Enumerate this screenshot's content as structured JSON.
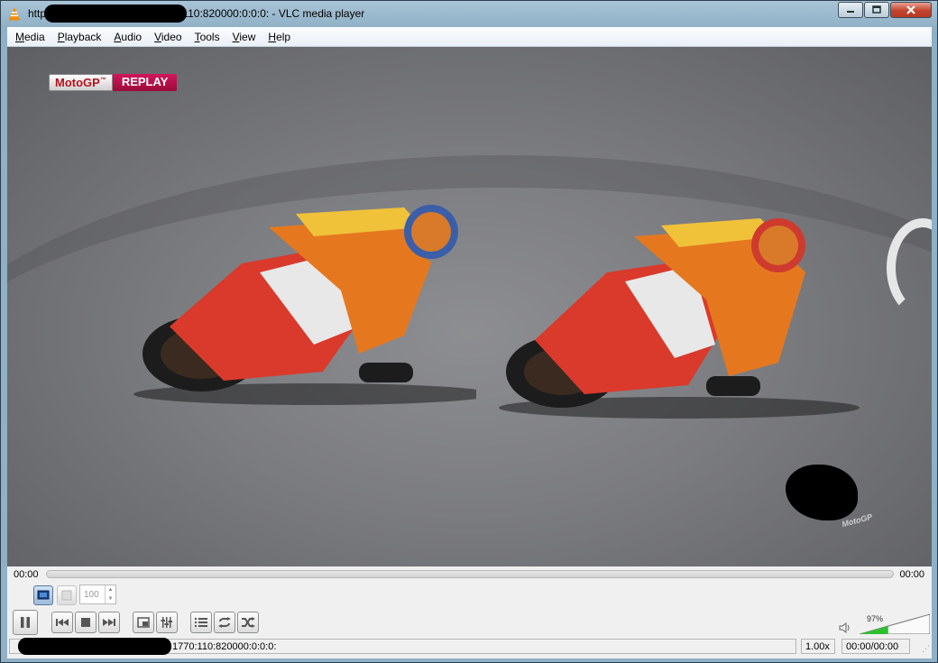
{
  "window": {
    "title": "http                         770:110:820000:0:0:0: - VLC media player",
    "title_suffix": ":110:820000:0:0:0: - VLC media player",
    "title_prefix": "http"
  },
  "menu": {
    "items": [
      {
        "first": "M",
        "rest": "edia"
      },
      {
        "first": "P",
        "rest": "layback"
      },
      {
        "first": "A",
        "rest": "udio"
      },
      {
        "first": "V",
        "rest": "ideo"
      },
      {
        "first": "T",
        "rest": "ools"
      },
      {
        "first": "V",
        "rest": "iew"
      },
      {
        "first": "H",
        "rest": "elp"
      }
    ]
  },
  "video": {
    "badge_brand": "MotoGP",
    "badge_mark": "™",
    "badge_replay": "REPLAY",
    "watermark": "MotoGP"
  },
  "playback": {
    "elapsed": "00:00",
    "remaining": "00:00",
    "position": 0.0,
    "frame_step_value": "100",
    "speed": "1.00x",
    "time_status": "00:00/00:00",
    "status_url": "1770:110:820000:0:0:0:"
  },
  "volume": {
    "percent_label": "97%",
    "level": 0.97,
    "accent": "#2fbf2f"
  },
  "colors": {
    "replay": "#c2124f",
    "close_button": "#c2432c"
  }
}
